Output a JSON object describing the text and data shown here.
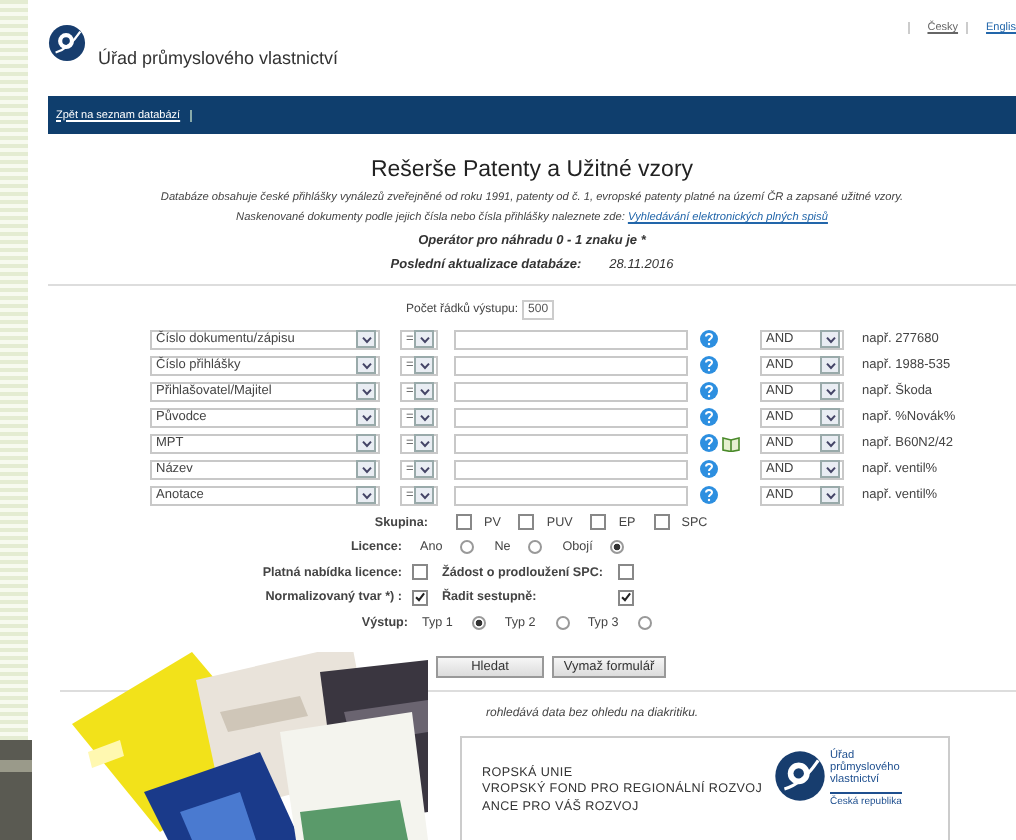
{
  "header": {
    "title": "Úřad průmyslového vlastnictví",
    "languages": [
      {
        "label": "Česky"
      },
      {
        "label": "Englis"
      }
    ]
  },
  "nav": {
    "links": [
      "Zpět na seznam databází"
    ]
  },
  "heading": "Rešerše Patenty a Užitné vzory",
  "intro": [
    {
      "text": "Databáze obsahuje české přihlášky vynálezů zveřejněné od roku 1991, patenty od č. 1, evropské patenty platné na území ČR a zapsané užitné vzory."
    },
    {
      "text": "Naskenované dokumenty podle jejich čísla nebo čísla přihlášky naleznete zde: ",
      "link": "Vyhledávání elektronických plných spisů"
    }
  ],
  "operator_note": "Operátor pro náhradu 0 - 1 znaku je *",
  "last_update": {
    "label": "Poslední aktualizace databáze:",
    "value": "28.11.2016"
  },
  "rows_count": {
    "label": "Počet řádků výstupu:",
    "value": "500"
  },
  "criteria": [
    {
      "field": "Číslo dokumentu/zápisu",
      "operator": "=",
      "connector": "AND",
      "example": "např. 277680",
      "lookup": false
    },
    {
      "field": "Číslo přihlášky",
      "operator": "=",
      "connector": "AND",
      "example": "např. 1988-535",
      "lookup": false
    },
    {
      "field": "Přihlašovatel/Majitel",
      "operator": "=",
      "connector": "AND",
      "example": "např. Škoda",
      "lookup": false
    },
    {
      "field": "Původce",
      "operator": "=",
      "connector": "AND",
      "example": "např. %Novák%",
      "lookup": false
    },
    {
      "field": "MPT",
      "operator": "=",
      "connector": "AND",
      "example": "např. B60N2/42",
      "lookup": true
    },
    {
      "field": "Název",
      "operator": "=",
      "connector": "AND",
      "example": "např. ventil%",
      "lookup": false
    },
    {
      "field": "Anotace",
      "operator": "=",
      "connector": "AND",
      "example": "např. ventil%",
      "lookup": false
    }
  ],
  "group": {
    "label": "Skupina:",
    "options": [
      {
        "label": "PV",
        "checked": false
      },
      {
        "label": "PUV",
        "checked": false
      },
      {
        "label": "EP",
        "checked": false
      },
      {
        "label": "SPC",
        "checked": false
      }
    ]
  },
  "licence": {
    "label": "Licence:",
    "options": [
      {
        "label": "Ano",
        "selected": false
      },
      {
        "label": "Ne",
        "selected": false
      },
      {
        "label": "Obojí",
        "selected": true
      }
    ]
  },
  "flags": [
    {
      "label": "Platná nabídka licence:",
      "checked": false
    },
    {
      "label": "Žádost o prodloužení SPC:",
      "checked": false
    },
    {
      "label": "Normalizovaný tvar *) :",
      "checked": true
    },
    {
      "label": "Řadit sestupně:",
      "checked": true
    }
  ],
  "output": {
    "label": "Výstup:",
    "options": [
      {
        "label": "Typ 1",
        "selected": true
      },
      {
        "label": "Typ 2",
        "selected": false
      },
      {
        "label": "Typ 3",
        "selected": false
      }
    ]
  },
  "buttons": [
    "Hledat",
    "Vymaž formulář"
  ],
  "note": "rohledává data bez ohledu na diakritiku.",
  "banner": {
    "lines": [
      "ROPSKÁ UNIE",
      "VROPSKÝ FOND PRO REGIONÁLNÍ ROZVOJ",
      "ANCE PRO VÁŠ ROZVOJ"
    ],
    "logo_lines": [
      "Úřad",
      "průmyslového",
      "vlastnictví"
    ],
    "logo_country": "Česká republika"
  },
  "promo": {
    "kind": "picture"
  }
}
